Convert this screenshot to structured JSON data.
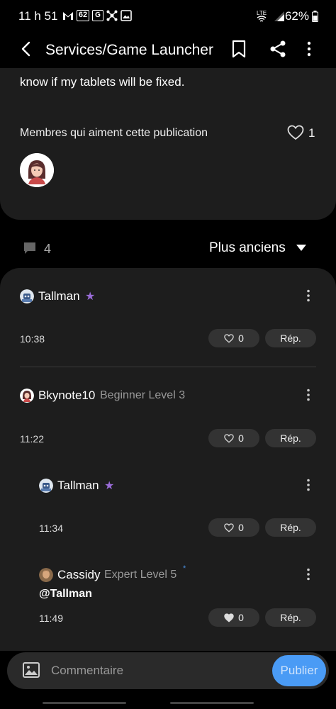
{
  "status_bar": {
    "time": "11 h 51",
    "notif_icons": [
      "gmail-icon",
      "62-badge-icon",
      "translate-icon",
      "network-icon",
      "gallery-icon"
    ],
    "badge_text": "62",
    "battery": "62%",
    "net_label": "LTE"
  },
  "app_bar": {
    "title": "Services/Game Launcher"
  },
  "post": {
    "tail_text": "know if my tablets will be fixed.",
    "likers_label": "Membres qui aiment cette publication",
    "like_count": "1"
  },
  "comments_header": {
    "count": "4",
    "sort_label": "Plus anciens"
  },
  "comments": [
    {
      "author": "Tallman",
      "level": "",
      "time": "10:38",
      "likes": "0",
      "reply": "Rép.",
      "heart_filled": false
    },
    {
      "author": "Bkynote10",
      "level": "Beginner Level 3",
      "time": "11:22",
      "likes": "0",
      "reply": "Rép.",
      "heart_filled": false
    },
    {
      "author": "Tallman",
      "level": "",
      "time": "11:34",
      "likes": "0",
      "reply": "Rép.",
      "heart_filled": false
    },
    {
      "author": "Cassidy",
      "level": "Expert Level 5",
      "body": "@Tallman",
      "time": "11:49",
      "likes": "0",
      "reply": "Rép.",
      "heart_filled": true
    }
  ],
  "composer": {
    "placeholder": "Commentaire",
    "publish_label": "Publier"
  },
  "colors": {
    "background": "#000000",
    "card": "#1d1d1d",
    "accent": "#4a9bf5",
    "star": "#9a6cd8"
  }
}
